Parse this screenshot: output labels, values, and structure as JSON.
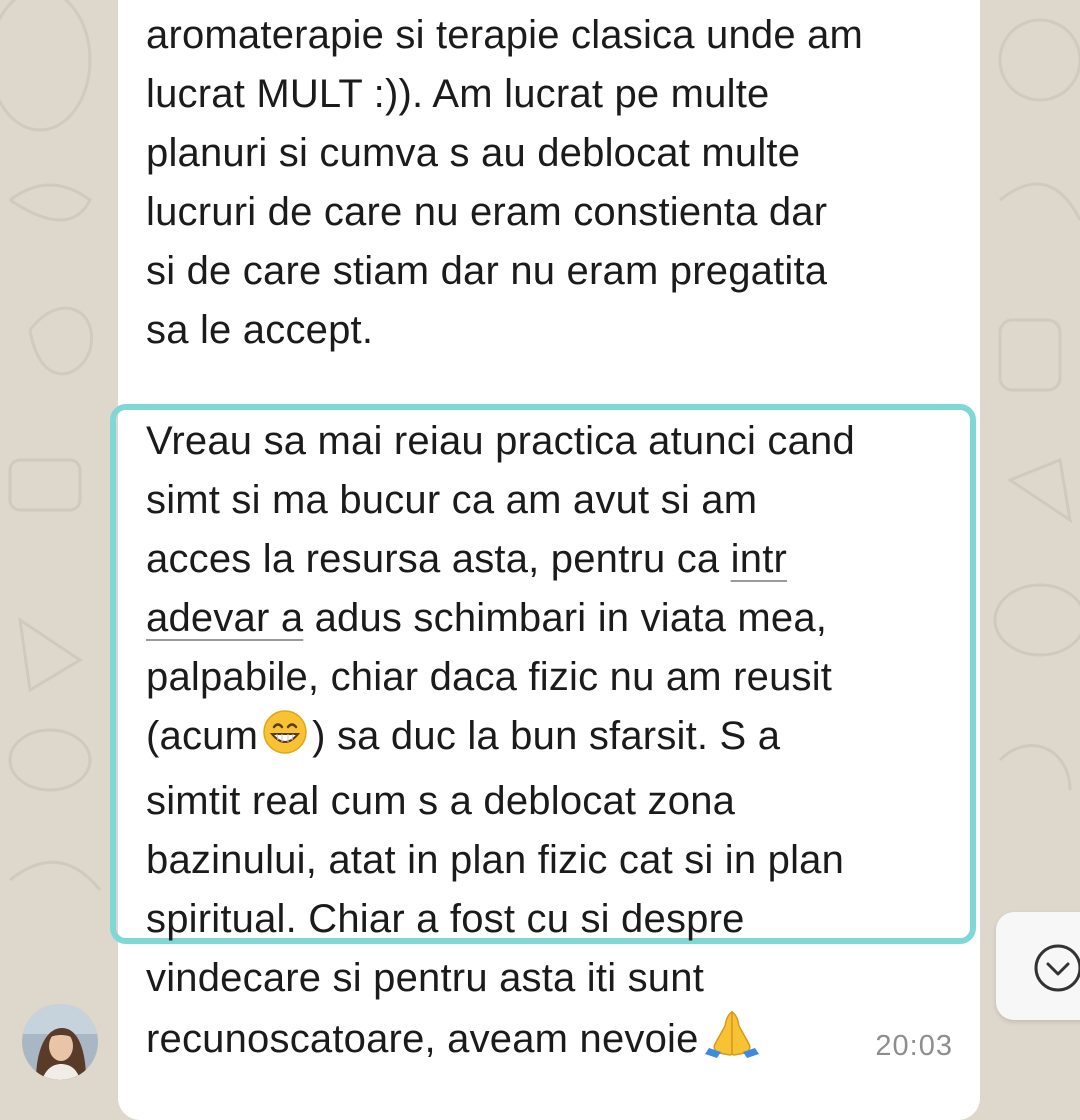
{
  "message": {
    "paragraph_1": [
      "aromaterapie si terapie clasica unde am",
      "lucrat MULT :)). Am lucrat pe multe",
      "planuri si cumva s au deblocat multe",
      "lucruri de care nu eram constienta dar",
      "si de care stiam dar nu eram pregatita",
      "sa le accept."
    ],
    "paragraph_2": {
      "line_1": "Vreau sa mai reiau practica atunci cand",
      "line_2": "simt si ma bucur ca am avut si am",
      "line_3_before": "acces la resursa asta, pentru ca ",
      "line_3_link": "intr",
      "line_4_link": "adevar a",
      "line_4_after": " adus schimbari in viata mea,",
      "line_5": "palpabile, chiar daca fizic nu am reusit",
      "line_6_before": "(acum",
      "line_6_after": ") sa duc la bun sfarsit. S a",
      "line_7": "simtit real cum s a deblocat zona",
      "line_8": "bazinului, atat in plan fizic cat si in plan",
      "line_9": "spiritual. Chiar a fost cu si despre",
      "line_10": "vindecare si pentru asta iti sunt",
      "line_11": "recunoscatoare, aveam nevoie"
    },
    "timestamp": "20:03"
  },
  "icons": {
    "emoji_1": "grinning-face-emoji",
    "emoji_2": "folded-hands-emoji",
    "side_button": "chevron-down-circle-icon"
  },
  "colors": {
    "highlight_border": "#7fd8d6",
    "bubble": "#ffffff",
    "wallpaper": "#ddd7cc",
    "timestamp": "#8e8e8e"
  }
}
